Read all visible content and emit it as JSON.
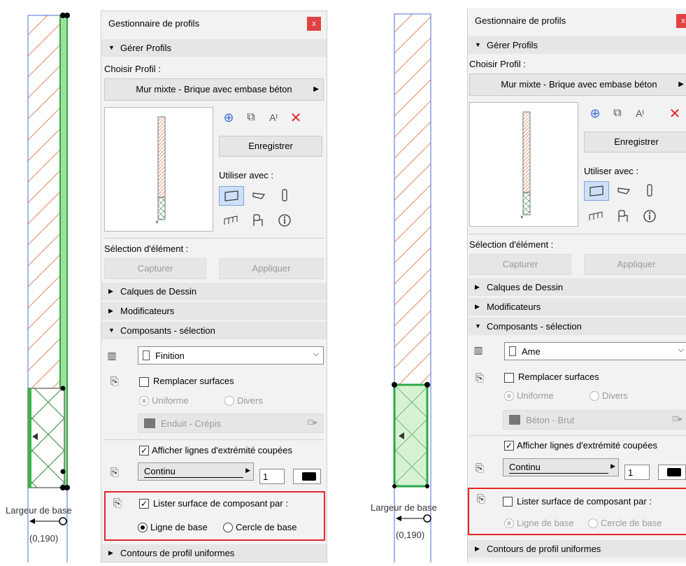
{
  "panel_title": "Gestionnaire de profils",
  "close_label": "x",
  "sections": {
    "manage": "Gérer Profils",
    "layers": "Calques de Dessin",
    "modifiers": "Modificateurs",
    "components": "Composants - sélection",
    "contours": "Contours de profil uniformes"
  },
  "choose_profile_label": "Choisir Profil :",
  "profile_name": "Mur mixte - Brique avec embase béton",
  "save_button": "Enregistrer",
  "use_with_label": "Utiliser avec :",
  "element_selection_label": "Sélection d'élément :",
  "capture_button": "Capturer",
  "apply_button": "Appliquer",
  "replace_surfaces": "Remplacer surfaces",
  "uniform": "Uniforme",
  "various": "Divers",
  "show_cut_end_lines": "Afficher lignes d'extrémité coupées",
  "line_type": "Continu",
  "pen_number": "1",
  "list_surface_by": "Lister surface de composant par :",
  "base_line": "Ligne de base",
  "base_circle": "Cercle de base",
  "base_width_label": "Largeur de base",
  "base_coord": "(0,190)",
  "left": {
    "component": "Finition",
    "surface": "Enduit - Crépis",
    "list_surface_checked": true,
    "baseline_selected": true
  },
  "right": {
    "component": "Ame",
    "surface": "Béton - Brut",
    "list_surface_checked": false,
    "baseline_selected": true
  },
  "colors": {
    "highlight_red": "#e5262b",
    "selection_green": "#3cb44b",
    "hatch_orange": "#e0895a"
  }
}
